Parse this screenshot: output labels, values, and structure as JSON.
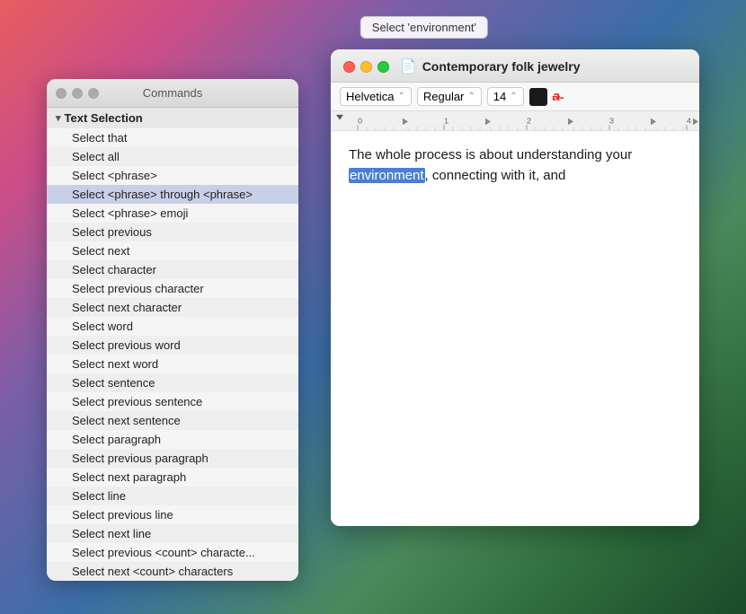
{
  "tooltip": {
    "text": "Select 'environment'"
  },
  "commands_panel": {
    "title": "Commands",
    "section_label": "Text Selection",
    "items": [
      "Select that",
      "Select all",
      "Select <phrase>",
      "Select <phrase> through <phrase>",
      "Select <phrase> emoji",
      "Select previous",
      "Select next",
      "Select character",
      "Select previous character",
      "Select next character",
      "Select word",
      "Select previous word",
      "Select next word",
      "Select sentence",
      "Select previous sentence",
      "Select next sentence",
      "Select paragraph",
      "Select previous paragraph",
      "Select next paragraph",
      "Select line",
      "Select previous line",
      "Select next line",
      "Select previous <count> characte...",
      "Select next <count> characters"
    ],
    "highlighted_index": 3
  },
  "editor": {
    "title": "Contemporary folk jewelry",
    "doc_icon": "📄",
    "toolbar": {
      "font": "Helvetica",
      "style": "Regular",
      "size": "14"
    },
    "content_before": "The whole process is about understanding your ",
    "content_highlight": "environment",
    "content_after": ", connecting with it, and"
  }
}
